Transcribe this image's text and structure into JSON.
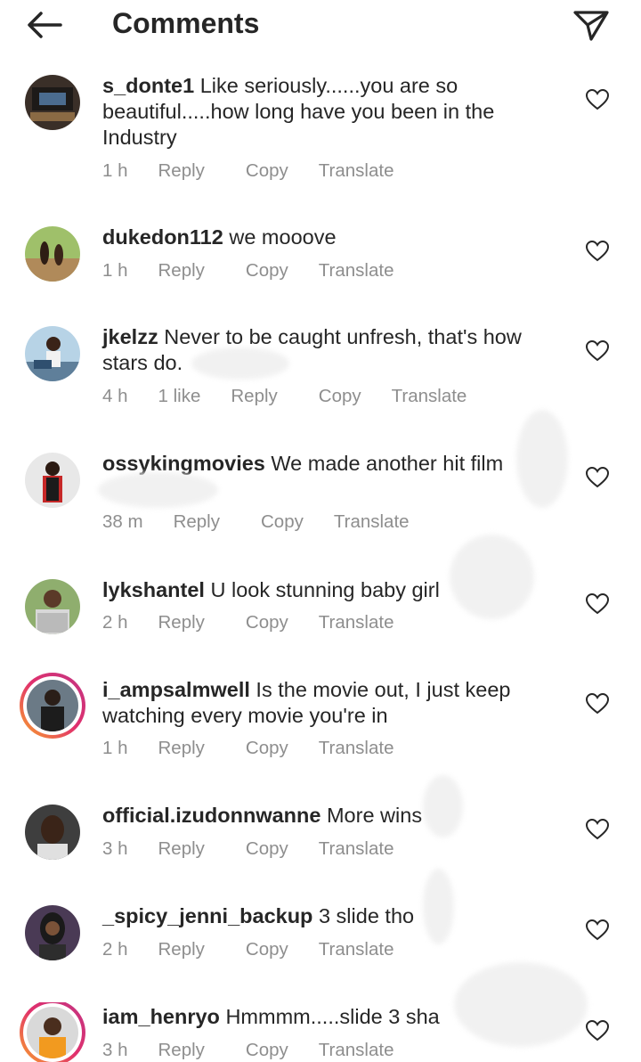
{
  "header": {
    "title": "Comments",
    "back_icon": "arrow-left-icon",
    "send_icon": "paper-plane-icon"
  },
  "comments": [
    {
      "username": "s_donte1",
      "text": "Like seriously......you are so beautiful.....how long have you been in the Industry",
      "time": "1 h",
      "likes": "",
      "reply": "Reply",
      "copy": "Copy",
      "translate": "Translate"
    },
    {
      "username": "dukedon112",
      "text": "we mooove",
      "time": "1 h",
      "likes": "",
      "reply": "Reply",
      "copy": "Copy",
      "translate": "Translate"
    },
    {
      "username": "jkelzz",
      "text": "Never to be caught unfresh, that's how stars do.",
      "time": "4 h",
      "likes": "1 like",
      "reply": "Reply",
      "copy": "Copy",
      "translate": "Translate"
    },
    {
      "username": "ossykingmovies",
      "text": "We made another hit  film",
      "time": "38 m",
      "likes": "",
      "reply": "Reply",
      "copy": "Copy",
      "translate": "Translate"
    },
    {
      "username": "lykshantel",
      "text": "U look stunning baby girl",
      "time": "2 h",
      "likes": "",
      "reply": "Reply",
      "copy": "Copy",
      "translate": "Translate"
    },
    {
      "username": "i_ampsalmwell",
      "text": "Is the movie out,  I just keep watching every movie you're in",
      "time": "1 h",
      "likes": "",
      "reply": "Reply",
      "copy": "Copy",
      "translate": "Translate"
    },
    {
      "username": "official.izudonnwanne",
      "text": "More wins",
      "time": "3 h",
      "likes": "",
      "reply": "Reply",
      "copy": "Copy",
      "translate": "Translate"
    },
    {
      "username": "_spicy_jenni_backup",
      "text": "3 slide tho",
      "time": "2 h",
      "likes": "",
      "reply": "Reply",
      "copy": "Copy",
      "translate": "Translate"
    },
    {
      "username": "iam_henryo",
      "text": "Hmmmm.....slide 3 sha",
      "time": "3 h",
      "likes": "",
      "reply": "Reply",
      "copy": "Copy",
      "translate": "Translate"
    }
  ],
  "colors": {
    "text": "#262626",
    "meta": "#8e8e8e",
    "story_ring_start": "#f9a62a",
    "story_ring_end": "#c13584"
  }
}
